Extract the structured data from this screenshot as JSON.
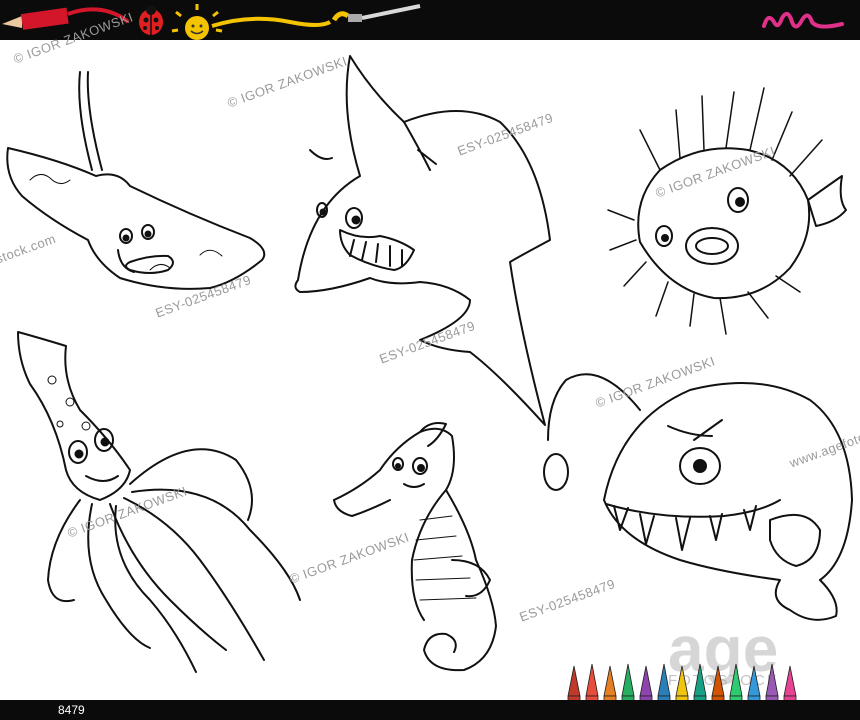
{
  "watermarks": {
    "author": "© IGOR ZAKOWSKI",
    "image_code": "ESY-025458479",
    "agency_logo": "age",
    "agency_sub": "FOTOSTOCK",
    "agency_url": "www.agefotostock.com",
    "stock_fragment": "stock.com",
    "bottom_code_fragment": "8479"
  },
  "icons": [
    "crayon-icon",
    "ladybug-icon",
    "sun-icon",
    "paintbrush-icon",
    "pink-scribble-icon",
    "colored-pencils-icon"
  ],
  "animals": [
    "stingray",
    "shark",
    "pufferfish",
    "squid",
    "seahorse",
    "anglerfish"
  ],
  "colors": {
    "bar": "#0b0b0b",
    "crayon_red": "#d4162a",
    "ladybug_red": "#e02020",
    "sun_yellow": "#f5c400",
    "scribble_pink": "#e0308a",
    "line_art": "#111111"
  }
}
